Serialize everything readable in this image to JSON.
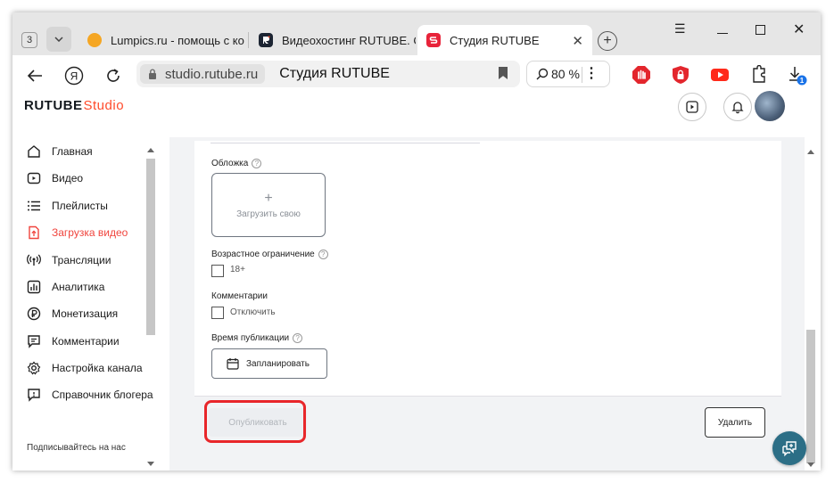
{
  "browser": {
    "tab_count": "3",
    "tabs": [
      {
        "label": "Lumpics.ru - помощь с ко",
        "favicon_color": "#f5a623"
      },
      {
        "label": "Видеохостинг RUTUBE. С",
        "favicon_color": "#1d2533"
      },
      {
        "label": "Студия RUTUBE",
        "favicon_color": "#e8233a",
        "active": true
      }
    ],
    "address": {
      "domain": "studio.rutube.ru",
      "title": "Студия RUTUBE"
    },
    "zoom": "80 %",
    "download_badge": "1",
    "icons": [
      "back-icon",
      "yandex-icon",
      "reload-icon",
      "lock-icon",
      "bookmark-icon",
      "zoom-icon",
      "adblock-icon",
      "shield-icon",
      "youtube-icon",
      "extension-icon",
      "download-icon"
    ]
  },
  "studio": {
    "logo_brand": "RUTUBE",
    "logo_suffix": "Studio",
    "accent_color": "#f0443d"
  },
  "sidebar": {
    "items": [
      {
        "label": "Главная",
        "icon": "home-icon"
      },
      {
        "label": "Видео",
        "icon": "video-icon"
      },
      {
        "label": "Плейлисты",
        "icon": "playlist-icon"
      },
      {
        "label": "Загрузка видео",
        "icon": "upload-icon",
        "active": true
      },
      {
        "label": "Трансляции",
        "icon": "broadcast-icon"
      },
      {
        "label": "Аналитика",
        "icon": "analytics-icon"
      },
      {
        "label": "Монетизация",
        "icon": "monetization-icon"
      },
      {
        "label": "Комментарии",
        "icon": "comments-icon"
      },
      {
        "label": "Настройка канала",
        "icon": "settings-icon"
      },
      {
        "label": "Справочник блогера",
        "icon": "help-icon"
      }
    ],
    "follow_label": "Подписывайтесь на нас"
  },
  "form": {
    "cover_label": "Обложка",
    "cover_upload": "Загрузить свою",
    "age_label": "Возрастное ограничение",
    "age_option": "18+",
    "comments_label": "Комментарии",
    "comments_option": "Отключить",
    "publish_time_label": "Время публикации",
    "schedule_button": "Запланировать",
    "publish_button": "Опубликовать",
    "delete_button": "Удалить"
  }
}
